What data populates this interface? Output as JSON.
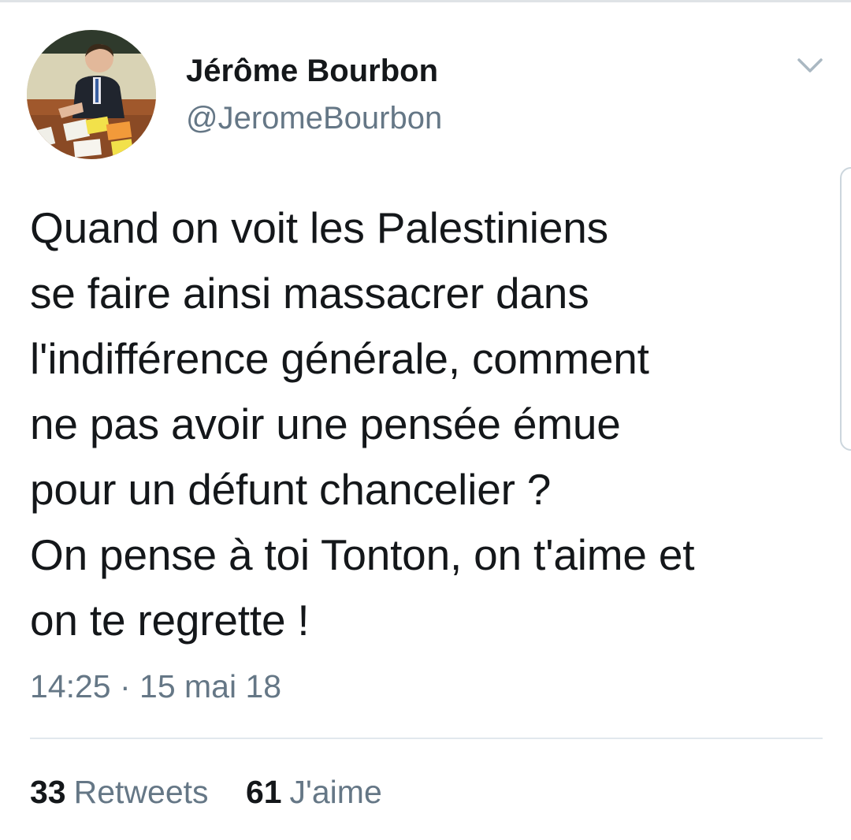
{
  "user": {
    "display_name": "Jérôme Bourbon",
    "handle": "@JeromeBourbon",
    "avatar_icon": "profile-photo"
  },
  "tweet": {
    "text": "Quand on voit les Palestiniens\nse faire ainsi massacrer dans\nl'indifférence générale, comment\nne pas avoir une pensée émue\npour un défunt chancelier ?\nOn pense à toi Tonton, on t'aime et\non te regrette !",
    "timestamp": "14:25 · 15 mai 18"
  },
  "stats": {
    "retweets_count": "33",
    "retweets_label": "Retweets",
    "likes_count": "61",
    "likes_label": "J'aime"
  },
  "icons": {
    "menu": "chevron-down-icon"
  },
  "colors": {
    "text_primary": "#14171a",
    "text_secondary": "#657786",
    "divider": "#e1e8ed"
  }
}
